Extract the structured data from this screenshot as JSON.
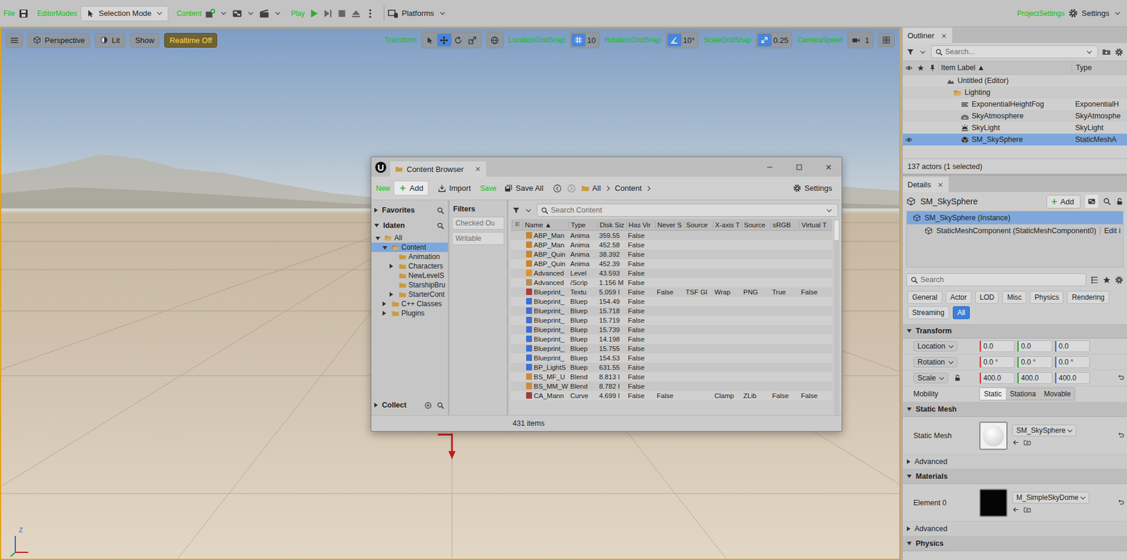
{
  "toolbar": {
    "items": [
      {
        "kind": "save",
        "tag": "File"
      },
      {
        "kind": "mode",
        "tag": "EditorModes",
        "label": "Selection Mode"
      },
      {
        "kind": "content",
        "tag": "Content"
      },
      {
        "kind": "play",
        "tag": "Play"
      },
      {
        "kind": "platforms",
        "label": "Platforms"
      }
    ],
    "settings_tag": "ProjectSettings",
    "settings": "Settings"
  },
  "viewport": {
    "buttons": [
      "Perspective",
      "Lit",
      "Show"
    ],
    "realtime": "Realtime Off",
    "transform_tag": "Transform",
    "tools": [
      {
        "kind": "select",
        "selected": false
      },
      {
        "kind": "move",
        "selected": true
      },
      {
        "kind": "rotate",
        "selected": false
      },
      {
        "kind": "scale",
        "selected": false
      }
    ],
    "snaps": [
      {
        "kind": "grid",
        "tag": "LocationGridSnap",
        "value": "10",
        "on": true
      },
      {
        "kind": "angle",
        "tag": "RotationGridSnap",
        "value": "10°",
        "on": true
      },
      {
        "kind": "scale",
        "tag": "ScaleGridSnap",
        "value": "0.25",
        "on": true
      }
    ],
    "camera_tag": "CameraSpeed",
    "camera_value": "1",
    "axis_label": "Z"
  },
  "outliner": {
    "title": "Outliner",
    "search": "Search...",
    "columns": [
      "Item Label ▲",
      "Type"
    ],
    "rows": [
      {
        "label": "Untitled (Editor)",
        "type": "",
        "kind": "world",
        "depth": 0,
        "selected": false,
        "visible": false
      },
      {
        "label": "Lighting",
        "type": "",
        "kind": "folder",
        "depth": 1,
        "selected": false,
        "visible": false
      },
      {
        "label": "ExponentialHeightFog",
        "type": "ExponentialH",
        "kind": "fog",
        "depth": 2,
        "selected": false,
        "visible": false
      },
      {
        "label": "SkyAtmosphere",
        "type": "SkyAtmosphe",
        "kind": "atmosphere",
        "depth": 2,
        "selected": false,
        "visible": false
      },
      {
        "label": "SkyLight",
        "type": "SkyLight",
        "kind": "skylight",
        "depth": 2,
        "selected": false,
        "visible": false
      },
      {
        "label": "SM_SkySphere",
        "type": "StaticMeshA",
        "kind": "mesh",
        "depth": 2,
        "selected": true,
        "visible": true
      }
    ],
    "footer": "137 actors (1 selected)"
  },
  "details": {
    "title": "Details",
    "actor": "SM_SkySphere",
    "add": "Add",
    "components": [
      {
        "label": "SM_SkySphere (Instance)",
        "depth": 0,
        "selected": true
      },
      {
        "label": "StaticMeshComponent (StaticMeshComponent0)",
        "depth": 1,
        "selected": false,
        "action": "Edit i"
      }
    ],
    "search": "Search",
    "filters": [
      {
        "label": "General",
        "selected": false
      },
      {
        "label": "Actor",
        "selected": false
      },
      {
        "label": "LOD",
        "selected": false
      },
      {
        "label": "Misc",
        "selected": false
      },
      {
        "label": "Physics",
        "selected": false
      },
      {
        "label": "Rendering",
        "selected": false
      },
      {
        "label": "Streaming",
        "selected": false
      },
      {
        "label": "All",
        "selected": true
      }
    ],
    "transform": {
      "title": "Transform",
      "expanded": true,
      "rows": [
        {
          "label": "Location",
          "values": [
            "0.0",
            "0.0",
            "0.0"
          ]
        },
        {
          "label": "Rotation",
          "values": [
            "0.0 °",
            "0.0 °",
            "0.0 °"
          ]
        },
        {
          "label": "Scale",
          "values": [
            "400.0",
            "400.0",
            "400.0"
          ]
        }
      ],
      "mobility": "Mobility",
      "mobility_options": [
        {
          "label": "Static",
          "selected": true
        },
        {
          "label": "Stationa",
          "selected": false
        },
        {
          "label": "Movable",
          "selected": false
        }
      ]
    },
    "static_mesh": {
      "title": "Static Mesh",
      "expanded": true,
      "label": "Static Mesh",
      "asset": "SM_SkySphere",
      "thumb": "#f1f1f1",
      "advanced": "Advanced",
      "advanced_expanded": false
    },
    "materials": {
      "title": "Materials",
      "expanded": true,
      "label": "Element 0",
      "asset": "M_SimpleSkyDome",
      "thumb": "#050505",
      "advanced": "Advanced",
      "advanced_expanded": false
    },
    "physics": {
      "title": "Physics",
      "expanded": true
    }
  },
  "content_browser": {
    "title": "Content Browser",
    "new_tag": "New",
    "add": "Add",
    "import": "Import",
    "save_tag": "Save",
    "save_all": "Save All",
    "path": [
      "All",
      "Content"
    ],
    "settings": "Settings",
    "favorites": {
      "label": "Favorites",
      "expanded": false
    },
    "project": {
      "label": "Idaten",
      "expanded": true
    },
    "tree": [
      {
        "label": "All",
        "depth": 0,
        "has_children": true,
        "expanded": true,
        "selected": false
      },
      {
        "label": "Content",
        "depth": 1,
        "has_children": true,
        "expanded": true,
        "selected": true
      },
      {
        "label": "Animation",
        "depth": 2,
        "has_children": false,
        "expanded": false,
        "selected": false
      },
      {
        "label": "Characters",
        "depth": 2,
        "has_children": true,
        "expanded": false,
        "selected": false
      },
      {
        "label": "NewLevelS",
        "depth": 2,
        "has_children": false,
        "expanded": false,
        "selected": false
      },
      {
        "label": "StarshipBru",
        "depth": 2,
        "has_children": false,
        "expanded": false,
        "selected": false
      },
      {
        "label": "StarterCont",
        "depth": 2,
        "has_children": true,
        "expanded": false,
        "selected": false
      },
      {
        "label": "C++ Classes",
        "depth": 1,
        "has_children": true,
        "expanded": false,
        "selected": false
      },
      {
        "label": "Plugins",
        "depth": 1,
        "has_children": true,
        "expanded": false,
        "selected": false
      }
    ],
    "collections": {
      "label": "Collect",
      "expanded": false
    },
    "filters_title": "Filters",
    "filters": [
      "Checked Ou",
      "Writable"
    ],
    "search": "Search Content",
    "columns": [
      "Name ▲",
      "Type",
      "Disk Siz",
      "Has Vir",
      "Never S",
      "Source",
      "X-axis T",
      "Source",
      "sRGB",
      "Virtual T"
    ],
    "rows": [
      {
        "cells": [
          "ABP_Man",
          "Anima",
          "359.55",
          "False"
        ],
        "color": "#c9842a"
      },
      {
        "cells": [
          "ABP_Man",
          "Anima",
          "452.58",
          "False"
        ],
        "color": "#c9842a"
      },
      {
        "cells": [
          "ABP_Quin",
          "Anima",
          "38.392",
          "False"
        ],
        "color": "#c9842a"
      },
      {
        "cells": [
          "ABP_Quin",
          "Anima",
          "452.39",
          "False"
        ],
        "color": "#c9842a"
      },
      {
        "cells": [
          "Advanced",
          "Level",
          "43.593",
          "False"
        ],
        "color": "#e0941c"
      },
      {
        "cells": [
          "Advanced",
          "/Scrip",
          "1.156 M",
          "False"
        ],
        "color": "#b98b4e"
      },
      {
        "cells": [
          "Blueprint_",
          "Textu",
          "5.059 I",
          "False",
          "False",
          "TSF GI",
          "Wrap",
          "PNG",
          "True",
          "False"
        ],
        "color": "#b33a3a"
      },
      {
        "cells": [
          "Blueprint_",
          "Bluep",
          "154.49",
          "False"
        ],
        "color": "#3d6fd6"
      },
      {
        "cells": [
          "Blueprint_",
          "Bluep",
          "15.718",
          "False"
        ],
        "color": "#3d6fd6"
      },
      {
        "cells": [
          "Blueprint_",
          "Bluep",
          "15.719",
          "False"
        ],
        "color": "#3d6fd6"
      },
      {
        "cells": [
          "Blueprint_",
          "Bluep",
          "15.739",
          "False"
        ],
        "color": "#3d6fd6"
      },
      {
        "cells": [
          "Blueprint_",
          "Bluep",
          "14.198",
          "False"
        ],
        "color": "#3d6fd6"
      },
      {
        "cells": [
          "Blueprint_",
          "Bluep",
          "15.755",
          "False"
        ],
        "color": "#3d6fd6"
      },
      {
        "cells": [
          "Blueprint_",
          "Bluep",
          "154.53",
          "False"
        ],
        "color": "#3d6fd6"
      },
      {
        "cells": [
          "BP_LightS",
          "Bluep",
          "631.55",
          "False"
        ],
        "color": "#3d6fd6"
      },
      {
        "cells": [
          "BS_MF_U",
          "Blend",
          "8.813 I",
          "False"
        ],
        "color": "#d08a3a"
      },
      {
        "cells": [
          "BS_MM_W",
          "Blend",
          "8.782 I",
          "False"
        ],
        "color": "#d08a3a"
      },
      {
        "cells": [
          "CA_Mann",
          "Curve",
          "4.699 I",
          "False",
          "False",
          "",
          "Clamp",
          "ZLib",
          "False",
          "False"
        ],
        "color": "#a53a3a"
      }
    ],
    "count": "431 items"
  }
}
